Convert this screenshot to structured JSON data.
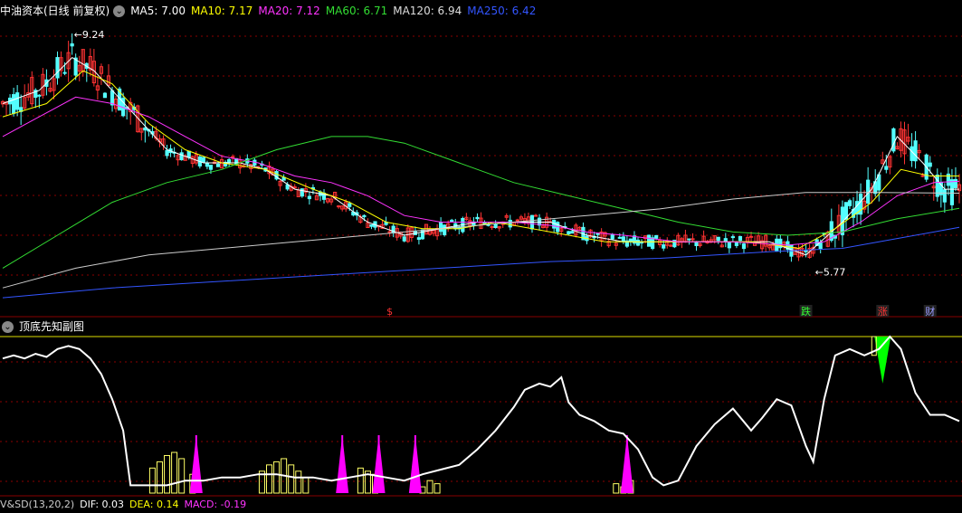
{
  "main_header": {
    "title": "中油资本(日线 前复权)",
    "ma": [
      {
        "label": "MA5: 7.00",
        "color": "#ffffff"
      },
      {
        "label": "MA10: 7.17",
        "color": "#ffff00"
      },
      {
        "label": "MA20: 7.12",
        "color": "#ff33ff"
      },
      {
        "label": "MA60: 6.71",
        "color": "#33dd33"
      },
      {
        "label": "MA120: 6.94",
        "color": "#dddddd"
      },
      {
        "label": "MA250: 6.42",
        "color": "#3355ff"
      }
    ]
  },
  "sub_header": {
    "title": "顶底先知副图"
  },
  "bottom_header": {
    "items": [
      {
        "label": "V&SD(13,20,2)",
        "color": "#cccccc"
      },
      {
        "label": "DIF: 0.03",
        "color": "#ffffff"
      },
      {
        "label": "DEA: 0.14",
        "color": "#ffff00"
      },
      {
        "label": "MACD: -0.19",
        "color": "#ff33ff"
      }
    ]
  },
  "colors": {
    "up": "#ff3333",
    "down": "#54ffff",
    "grid": "#8b0000",
    "bars": "#ffff66",
    "pink": "#ff00ff",
    "green": "#00ff00"
  },
  "chart_data": [
    {
      "type": "candlestick",
      "name": "main",
      "ylim": [
        5.2,
        9.6
      ],
      "annotations": [
        {
          "label": "9.24",
          "index": 19
        },
        {
          "label": "5.77",
          "index": 222
        }
      ],
      "markers": [
        {
          "label": "$",
          "index": 106,
          "color": "#ff3333"
        },
        {
          "label": "跌",
          "index": 220,
          "color": "#33ff33"
        },
        {
          "label": "涨",
          "index": 241,
          "color": "#ff3333"
        },
        {
          "label": "财",
          "index": 254,
          "color": "#9999ff"
        }
      ],
      "ma": {
        "MA5": {
          "color": "#ffffff",
          "points": [
            [
              0,
              8.3
            ],
            [
              10,
              8.5
            ],
            [
              19,
              9.0
            ],
            [
              25,
              8.8
            ],
            [
              35,
              8.2
            ],
            [
              45,
              7.6
            ],
            [
              55,
              7.4
            ],
            [
              65,
              7.4
            ],
            [
              72,
              7.3
            ],
            [
              80,
              7.0
            ],
            [
              90,
              6.9
            ],
            [
              100,
              6.5
            ],
            [
              110,
              6.3
            ],
            [
              120,
              6.4
            ],
            [
              130,
              6.5
            ],
            [
              140,
              6.5
            ],
            [
              150,
              6.5
            ],
            [
              160,
              6.3
            ],
            [
              170,
              6.2
            ],
            [
              180,
              6.2
            ],
            [
              190,
              6.2
            ],
            [
              200,
              6.2
            ],
            [
              210,
              6.2
            ],
            [
              220,
              6.0
            ],
            [
              230,
              6.5
            ],
            [
              238,
              7.0
            ],
            [
              245,
              7.8
            ],
            [
              252,
              7.4
            ],
            [
              258,
              7.0
            ],
            [
              262,
              7.0
            ]
          ]
        },
        "MA10": {
          "color": "#ffff00",
          "points": [
            [
              0,
              8.1
            ],
            [
              12,
              8.3
            ],
            [
              22,
              8.8
            ],
            [
              30,
              8.6
            ],
            [
              40,
              8.0
            ],
            [
              50,
              7.6
            ],
            [
              60,
              7.4
            ],
            [
              72,
              7.3
            ],
            [
              85,
              7.0
            ],
            [
              95,
              6.8
            ],
            [
              105,
              6.5
            ],
            [
              115,
              6.4
            ],
            [
              125,
              6.4
            ],
            [
              135,
              6.5
            ],
            [
              145,
              6.4
            ],
            [
              155,
              6.3
            ],
            [
              165,
              6.2
            ],
            [
              175,
              6.2
            ],
            [
              190,
              6.2
            ],
            [
              205,
              6.2
            ],
            [
              218,
              6.1
            ],
            [
              228,
              6.4
            ],
            [
              238,
              6.8
            ],
            [
              246,
              7.3
            ],
            [
              254,
              7.2
            ],
            [
              262,
              7.2
            ]
          ]
        },
        "MA20": {
          "color": "#ff33ff",
          "points": [
            [
              0,
              7.8
            ],
            [
              10,
              8.1
            ],
            [
              20,
              8.4
            ],
            [
              30,
              8.3
            ],
            [
              40,
              8.1
            ],
            [
              50,
              7.8
            ],
            [
              60,
              7.5
            ],
            [
              70,
              7.4
            ],
            [
              80,
              7.2
            ],
            [
              90,
              7.1
            ],
            [
              100,
              6.9
            ],
            [
              110,
              6.6
            ],
            [
              120,
              6.5
            ],
            [
              130,
              6.5
            ],
            [
              140,
              6.5
            ],
            [
              150,
              6.45
            ],
            [
              160,
              6.35
            ],
            [
              170,
              6.3
            ],
            [
              185,
              6.2
            ],
            [
              200,
              6.2
            ],
            [
              215,
              6.15
            ],
            [
              225,
              6.2
            ],
            [
              235,
              6.5
            ],
            [
              245,
              6.9
            ],
            [
              255,
              7.1
            ],
            [
              262,
              7.12
            ]
          ]
        },
        "MA60": {
          "color": "#33dd33",
          "points": [
            [
              0,
              5.8
            ],
            [
              15,
              6.3
            ],
            [
              30,
              6.8
            ],
            [
              45,
              7.1
            ],
            [
              60,
              7.3
            ],
            [
              75,
              7.6
            ],
            [
              90,
              7.8
            ],
            [
              100,
              7.8
            ],
            [
              110,
              7.7
            ],
            [
              125,
              7.4
            ],
            [
              140,
              7.1
            ],
            [
              155,
              6.9
            ],
            [
              170,
              6.7
            ],
            [
              185,
              6.5
            ],
            [
              200,
              6.35
            ],
            [
              215,
              6.3
            ],
            [
              230,
              6.35
            ],
            [
              245,
              6.55
            ],
            [
              262,
              6.71
            ]
          ]
        },
        "MA120": {
          "color": "#cccccc",
          "points": [
            [
              0,
              5.5
            ],
            [
              20,
              5.8
            ],
            [
              40,
              6.0
            ],
            [
              60,
              6.1
            ],
            [
              80,
              6.2
            ],
            [
              100,
              6.3
            ],
            [
              120,
              6.4
            ],
            [
              140,
              6.5
            ],
            [
              160,
              6.6
            ],
            [
              180,
              6.7
            ],
            [
              200,
              6.85
            ],
            [
              220,
              6.95
            ],
            [
              240,
              6.95
            ],
            [
              262,
              6.94
            ]
          ]
        },
        "MA250": {
          "color": "#3355ff",
          "points": [
            [
              0,
              5.35
            ],
            [
              30,
              5.5
            ],
            [
              60,
              5.6
            ],
            [
              90,
              5.7
            ],
            [
              120,
              5.8
            ],
            [
              150,
              5.9
            ],
            [
              180,
              5.95
            ],
            [
              210,
              6.05
            ],
            [
              230,
              6.1
            ],
            [
              250,
              6.3
            ],
            [
              262,
              6.42
            ]
          ]
        }
      }
    },
    {
      "type": "line",
      "name": "oscillator",
      "ylim": [
        0,
        100
      ],
      "series": [
        {
          "color": "#ffffff",
          "points": [
            [
              0,
              86
            ],
            [
              3,
              88
            ],
            [
              6,
              86
            ],
            [
              9,
              89
            ],
            [
              12,
              87
            ],
            [
              15,
              92
            ],
            [
              18,
              94
            ],
            [
              21,
              92
            ],
            [
              24,
              86
            ],
            [
              27,
              76
            ],
            [
              30,
              60
            ],
            [
              33,
              40
            ],
            [
              35,
              5
            ],
            [
              38,
              5
            ],
            [
              45,
              5
            ],
            [
              50,
              8
            ],
            [
              55,
              8
            ],
            [
              60,
              10
            ],
            [
              65,
              10
            ],
            [
              70,
              12
            ],
            [
              75,
              12
            ],
            [
              80,
              10
            ],
            [
              85,
              10
            ],
            [
              90,
              8
            ],
            [
              95,
              10
            ],
            [
              100,
              12
            ],
            [
              105,
              10
            ],
            [
              110,
              8
            ],
            [
              115,
              12
            ],
            [
              120,
              15
            ],
            [
              125,
              18
            ],
            [
              130,
              28
            ],
            [
              135,
              40
            ],
            [
              140,
              55
            ],
            [
              143,
              66
            ],
            [
              147,
              70
            ],
            [
              150,
              68
            ],
            [
              153,
              74
            ],
            [
              155,
              58
            ],
            [
              158,
              50
            ],
            [
              162,
              46
            ],
            [
              166,
              40
            ],
            [
              170,
              38
            ],
            [
              174,
              28
            ],
            [
              178,
              10
            ],
            [
              181,
              5
            ],
            [
              185,
              8
            ],
            [
              190,
              30
            ],
            [
              195,
              44
            ],
            [
              200,
              54
            ],
            [
              205,
              40
            ],
            [
              208,
              48
            ],
            [
              212,
              60
            ],
            [
              216,
              56
            ],
            [
              220,
              30
            ],
            [
              222,
              20
            ],
            [
              225,
              60
            ],
            [
              228,
              88
            ],
            [
              232,
              92
            ],
            [
              236,
              88
            ],
            [
              240,
              92
            ],
            [
              243,
              100
            ],
            [
              246,
              92
            ],
            [
              250,
              64
            ],
            [
              254,
              50
            ],
            [
              258,
              50
            ],
            [
              262,
              46
            ]
          ]
        }
      ],
      "ref_line": 100,
      "bars": [
        [
          41,
          16
        ],
        [
          43,
          20
        ],
        [
          45,
          24
        ],
        [
          47,
          26
        ],
        [
          49,
          22
        ],
        [
          52,
          12
        ],
        [
          71,
          14
        ],
        [
          73,
          18
        ],
        [
          75,
          20
        ],
        [
          77,
          22
        ],
        [
          79,
          18
        ],
        [
          81,
          14
        ],
        [
          83,
          10
        ],
        [
          98,
          16
        ],
        [
          100,
          14
        ],
        [
          102,
          12
        ],
        [
          115,
          4
        ],
        [
          117,
          8
        ],
        [
          119,
          6
        ],
        [
          168,
          6
        ],
        [
          170,
          4
        ],
        [
          172,
          8
        ]
      ],
      "spikes_pink": [
        53,
        93,
        103,
        113,
        171
      ],
      "spike_green": 241
    }
  ]
}
